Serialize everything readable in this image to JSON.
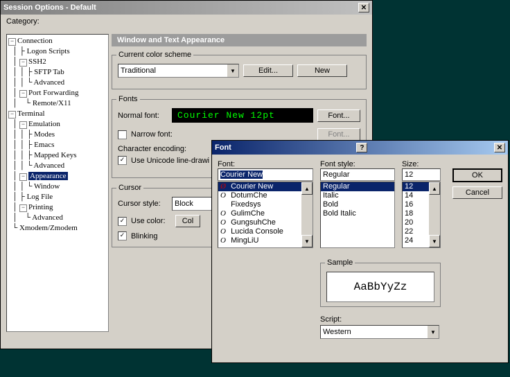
{
  "session": {
    "title": "Session Options - Default",
    "categoryLabel": "Category:",
    "tree": {
      "l0": "Connection",
      "l1": "Logon Scripts",
      "l2": "SSH2",
      "l3": "SFTP Tab",
      "l4": "Advanced",
      "l5": "Port Forwarding",
      "l6": "Remote/X11",
      "l7": "Terminal",
      "l8": "Emulation",
      "l9": "Modes",
      "l10": "Emacs",
      "l11": "Mapped Keys",
      "l12": "Advanced",
      "l13": "Appearance",
      "l14": "Window",
      "l15": "Log File",
      "l16": "Printing",
      "l17": "Advanced",
      "l18": "Xmodem/Zmodem"
    },
    "headerBar": "Window and Text Appearance",
    "colorScheme": {
      "group": "Current color scheme",
      "value": "Traditional",
      "edit": "Edit...",
      "new": "New"
    },
    "fonts": {
      "group": "Fonts",
      "normalLabel": "Normal font:",
      "preview": "Courier New 12pt",
      "fontBtn": "Font...",
      "narrowLabel": "Narrow font:",
      "encodingLabel": "Character encoding:",
      "unicodeLabel": "Use Unicode line-drawi"
    },
    "cursor": {
      "group": "Cursor",
      "styleLabel": "Cursor style:",
      "styleValue": "Block",
      "useColor": "Use color:",
      "colorBtn": "Col",
      "blinking": "Blinking"
    }
  },
  "font": {
    "title": "Font",
    "fontLabel": "Font:",
    "fontValue": "Courier New",
    "fontList": [
      "Courier New",
      "DotumChe",
      "Fixedsys",
      "GulimChe",
      "GungsuhChe",
      "Lucida Console",
      "MingLiU"
    ],
    "styleLabel": "Font style:",
    "styleValue": "Regular",
    "styleList": [
      "Regular",
      "Italic",
      "Bold",
      "Bold Italic"
    ],
    "sizeLabel": "Size:",
    "sizeValue": "12",
    "sizeList": [
      "12",
      "14",
      "16",
      "18",
      "20",
      "22",
      "24"
    ],
    "ok": "OK",
    "cancel": "Cancel",
    "sampleGroup": "Sample",
    "sampleText": "AaBbYyZz",
    "scriptLabel": "Script:",
    "scriptValue": "Western"
  }
}
